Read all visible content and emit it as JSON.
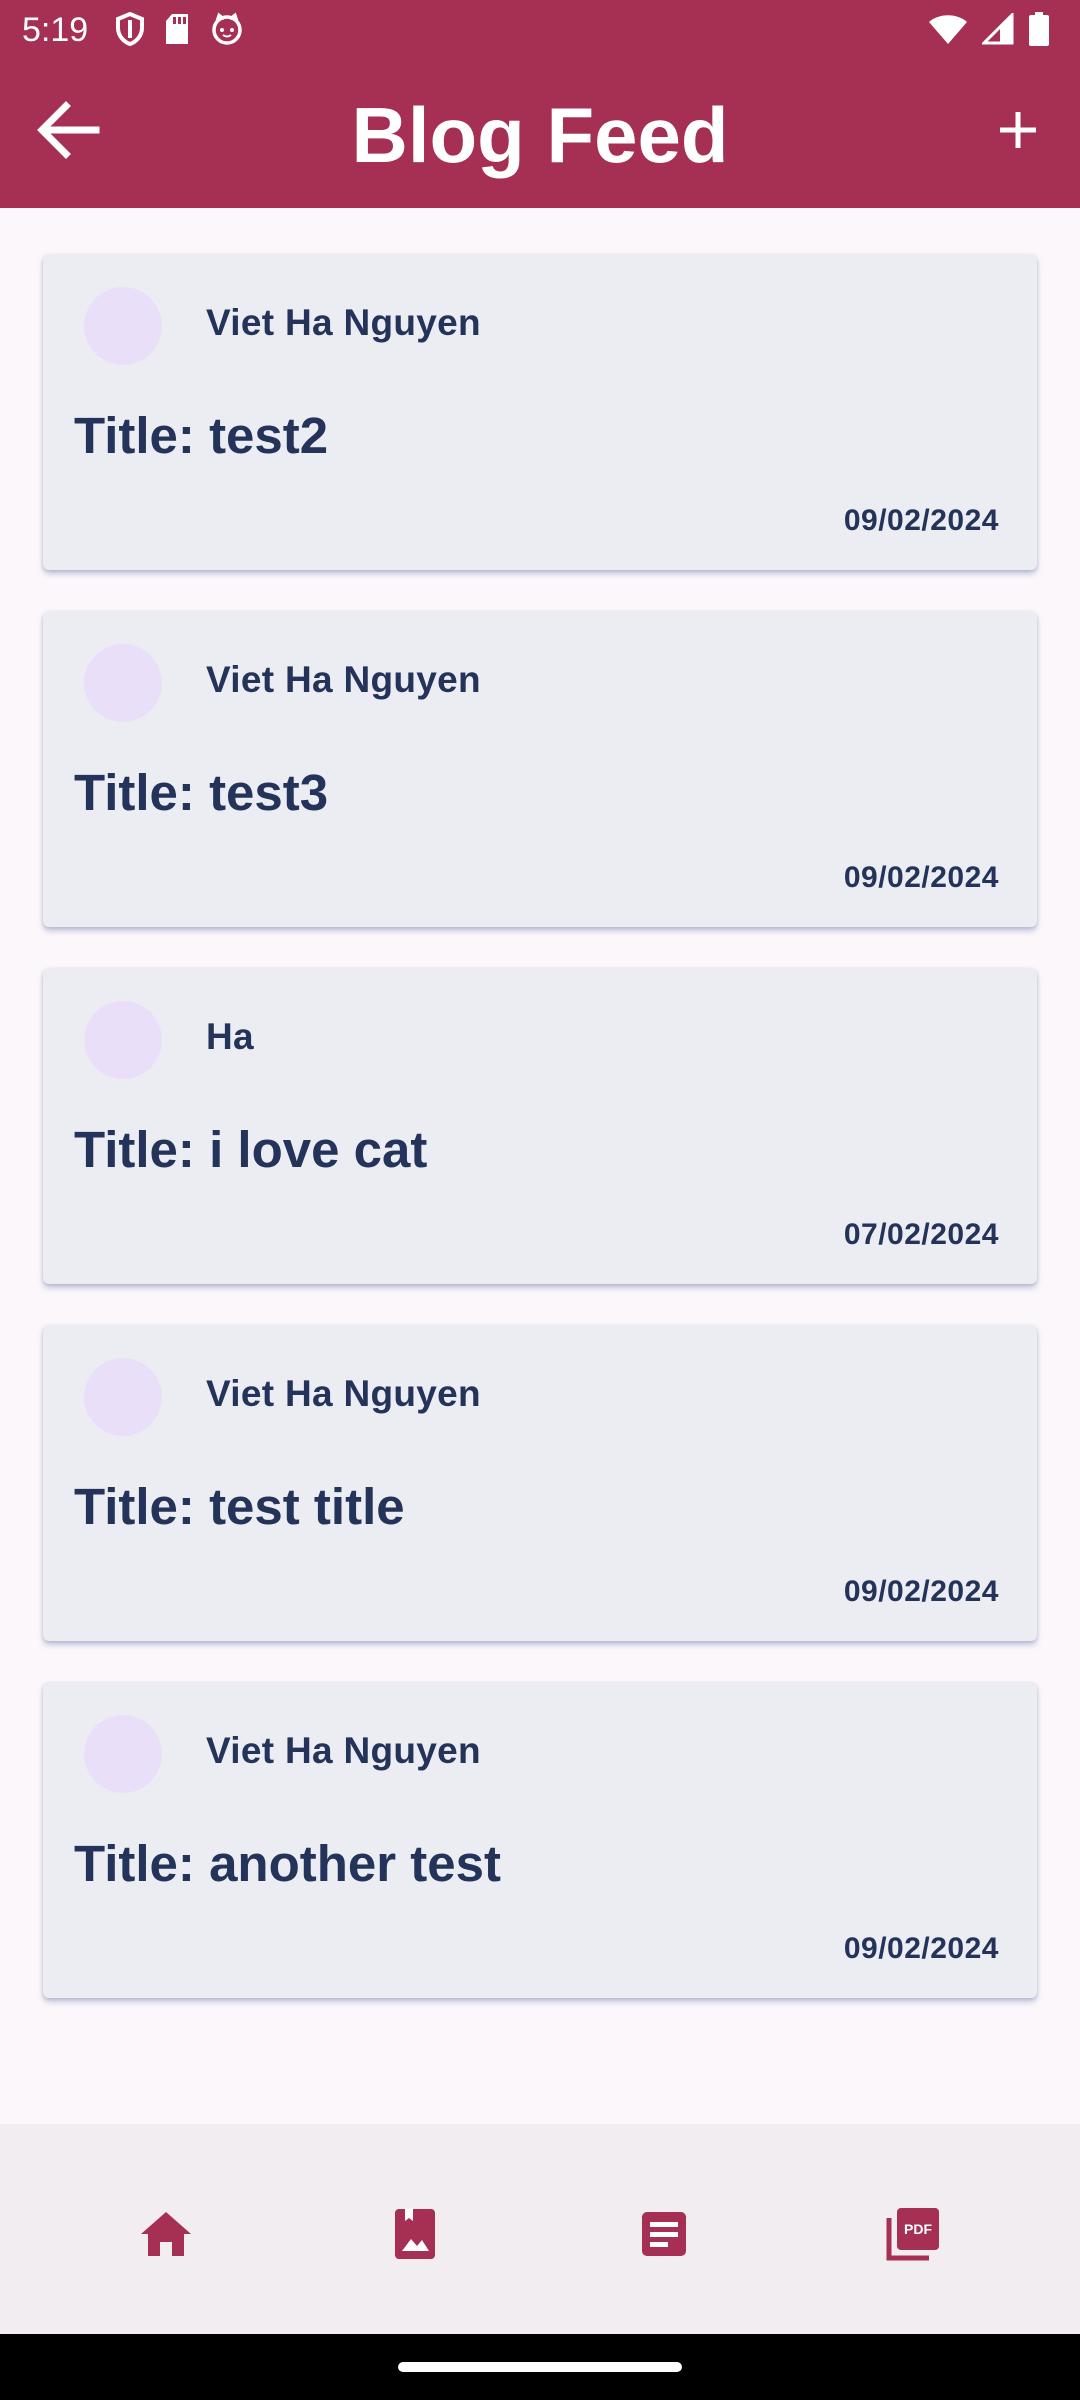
{
  "status_bar": {
    "time": "5:19",
    "left_icons": [
      "shield-icon",
      "sd-card-icon",
      "cat-face-icon"
    ],
    "right_icons": [
      "wifi-icon",
      "cell-signal-icon",
      "battery-icon"
    ]
  },
  "app_bar": {
    "title": "Blog Feed",
    "back_icon": "arrow-back-icon",
    "add_icon": "plus-icon"
  },
  "posts": [
    {
      "author": "Viet Ha Nguyen",
      "title": "Title: test2",
      "date": "09/02/2024"
    },
    {
      "author": "Viet Ha Nguyen",
      "title": "Title: test3",
      "date": "09/02/2024"
    },
    {
      "author": "Ha",
      "title": "Title: i love cat",
      "date": "07/02/2024"
    },
    {
      "author": "Viet Ha Nguyen",
      "title": "Title: test title",
      "date": "09/02/2024"
    },
    {
      "author": "Viet Ha Nguyen",
      "title": "Title: another test",
      "date": "09/02/2024"
    }
  ],
  "bottom_nav": {
    "items": [
      "home-icon",
      "photo-album-icon",
      "article-icon",
      "pdf-icon"
    ]
  },
  "colors": {
    "primary": "#a62f54",
    "card_background": "#ececf3",
    "text": "#233359",
    "avatar": "#eadff8",
    "nav_background": "#f1edf1"
  }
}
